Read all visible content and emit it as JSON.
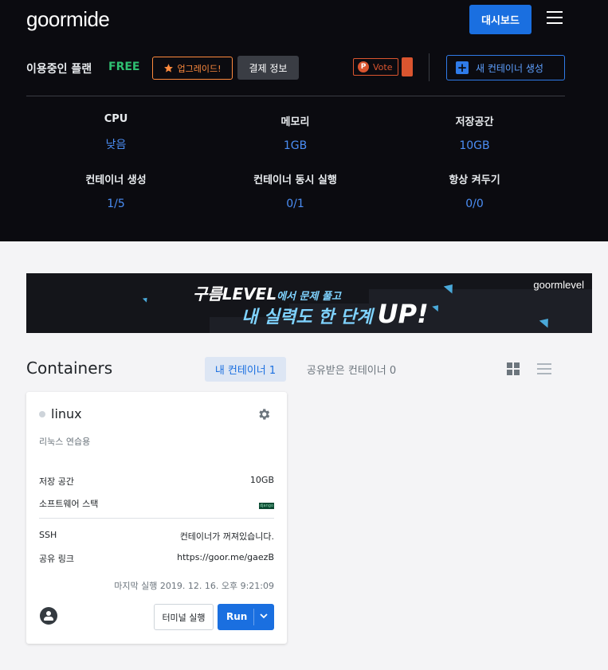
{
  "header": {
    "logo": "goormide",
    "dashboard_label": "대시보드",
    "plan_label": "이용중인 플랜",
    "plan_name": "FREE",
    "upgrade_label": "업그레이드!",
    "billing_label": "결제 정보",
    "vote_label": "Vote",
    "new_container_label": "새 컨테이너 생성"
  },
  "stats": [
    {
      "label": "CPU",
      "value": "낮음"
    },
    {
      "label": "메모리",
      "value": "1GB"
    },
    {
      "label": "저장공간",
      "value": "10GB"
    },
    {
      "label": "컨테이너 생성",
      "value": "1/5"
    },
    {
      "label": "컨테이너 동시 실행",
      "value": "0/1"
    },
    {
      "label": "항상 켜두기",
      "value": "0/0"
    }
  ],
  "banner": {
    "line1_brand": "구름LEVEL",
    "line1_rest": "에서 문제 풀고",
    "line2": "내 실력도 한 단계",
    "line2_up": "UP!",
    "brand": "goormlevel"
  },
  "containers": {
    "title": "Containers",
    "tab_mine": "내 컨테이너 1",
    "tab_shared": "공유받은 컨테이너 0"
  },
  "card": {
    "name": "linux",
    "description": "리눅스 연습용",
    "storage_label": "저장 공간",
    "storage_value": "10GB",
    "stack_label": "소프트웨어 스택",
    "stack_logo_text": "django",
    "ssh_label": "SSH",
    "ssh_value": "컨테이너가 꺼져있습니다.",
    "share_label": "공유 링크",
    "share_value": "https://goor.me/gaezB",
    "last_run": "마지막 실행 2019. 12. 16. 오후 9:21:09",
    "terminal_label": "터미널 실행",
    "run_label": "Run"
  },
  "colors": {
    "accent": "#1a6fe0",
    "plan_free": "#2fbf71",
    "upgrade": "#ff8a3d",
    "vote": "#da552f"
  }
}
